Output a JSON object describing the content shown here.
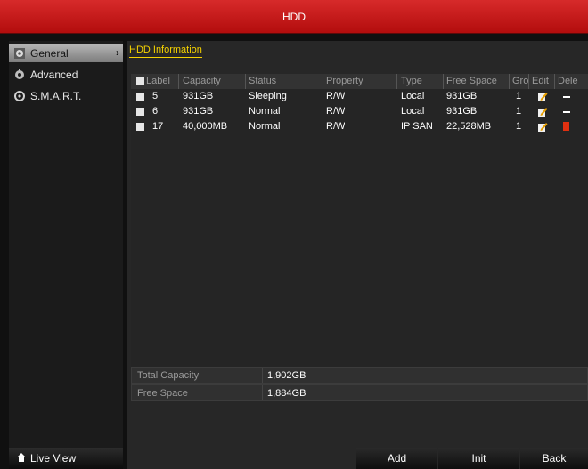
{
  "window": {
    "title": "HDD"
  },
  "sidebar": {
    "items": [
      {
        "label": "General",
        "icon": "gear-icon",
        "active": true
      },
      {
        "label": "Advanced",
        "icon": "advanced-gear-icon",
        "active": false
      },
      {
        "label": "S.M.A.R.T.",
        "icon": "smart-icon",
        "active": false
      }
    ],
    "live_view_label": "Live View"
  },
  "main": {
    "tab_label": "HDD Information",
    "table": {
      "headers": [
        "Label",
        "Capacity",
        "Status",
        "Property",
        "Type",
        "Free Space",
        "Gro",
        "Edit",
        "Dele"
      ],
      "rows": [
        {
          "label": "5",
          "capacity": "931GB",
          "status": "Sleeping",
          "property": "R/W",
          "type": "Local",
          "free_space": "931GB",
          "group": "1",
          "edit": "edit-icon",
          "delete": "none"
        },
        {
          "label": "6",
          "capacity": "931GB",
          "status": "Normal",
          "property": "R/W",
          "type": "Local",
          "free_space": "931GB",
          "group": "1",
          "edit": "edit-icon",
          "delete": "none"
        },
        {
          "label": "17",
          "capacity": "40,000MB",
          "status": "Normal",
          "property": "R/W",
          "type": "IP SAN",
          "free_space": "22,528MB",
          "group": "1",
          "edit": "edit-icon",
          "delete": "delete-icon"
        }
      ]
    },
    "summary": {
      "total_capacity_label": "Total Capacity",
      "total_capacity_value": "1,902GB",
      "free_space_label": "Free Space",
      "free_space_value": "1,884GB"
    },
    "buttons": {
      "add": "Add",
      "init": "Init",
      "back": "Back"
    }
  },
  "colors": {
    "title_red": "#c8161d",
    "tab_yellow": "#f5d200",
    "delete_red": "#e03010"
  }
}
